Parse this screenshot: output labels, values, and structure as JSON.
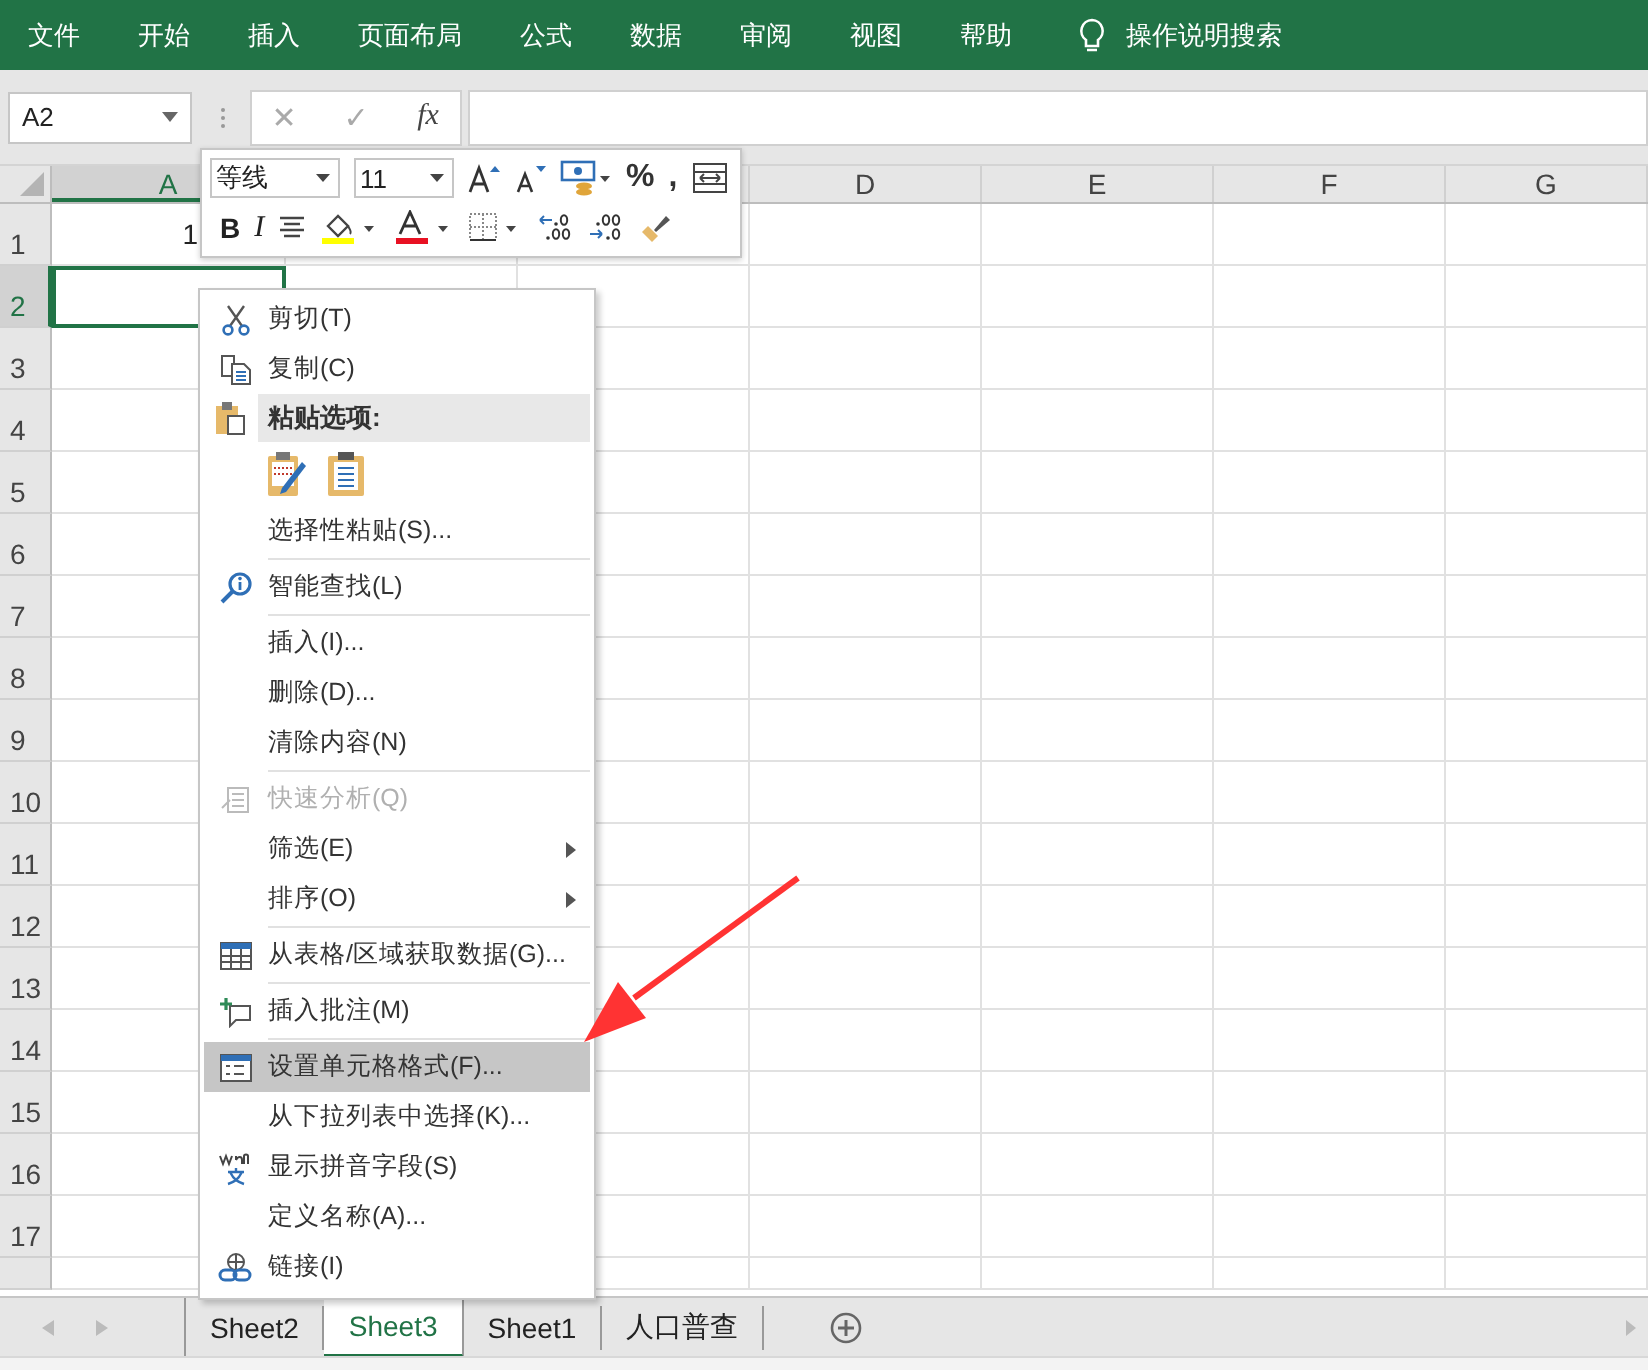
{
  "ribbon_tabs": [
    "文件",
    "开始",
    "插入",
    "页面布局",
    "公式",
    "数据",
    "审阅",
    "视图",
    "帮助"
  ],
  "tell_me": "操作说明搜索",
  "formula_bar": {
    "name_box": "A2",
    "cancel": "✕",
    "enter": "✓",
    "function": "fx"
  },
  "columns": [
    {
      "label": "A",
      "selected": true
    },
    {
      "label": "D",
      "selected": false
    },
    {
      "label": "E",
      "selected": false
    },
    {
      "label": "F",
      "selected": false
    },
    {
      "label": "G",
      "selected": false
    }
  ],
  "rows": [
    {
      "label": "1",
      "selected": false,
      "cells": [
        "1"
      ]
    },
    {
      "label": "2",
      "selected": true,
      "cells": []
    },
    {
      "label": "3",
      "selected": false,
      "cells": []
    },
    {
      "label": "4",
      "selected": false,
      "cells": []
    },
    {
      "label": "5",
      "selected": false,
      "cells": []
    },
    {
      "label": "6",
      "selected": false,
      "cells": []
    },
    {
      "label": "7",
      "selected": false,
      "cells": []
    },
    {
      "label": "8",
      "selected": false,
      "cells": []
    },
    {
      "label": "9",
      "selected": false,
      "cells": []
    },
    {
      "label": "10",
      "selected": false,
      "cells": []
    },
    {
      "label": "11",
      "selected": false,
      "cells": []
    },
    {
      "label": "12",
      "selected": false,
      "cells": []
    },
    {
      "label": "13",
      "selected": false,
      "cells": []
    },
    {
      "label": "14",
      "selected": false,
      "cells": []
    },
    {
      "label": "15",
      "selected": false,
      "cells": []
    },
    {
      "label": "16",
      "selected": false,
      "cells": []
    },
    {
      "label": "17",
      "selected": false,
      "cells": []
    }
  ],
  "mini_toolbar": {
    "font": "等线",
    "size": "11",
    "bold": "B",
    "italic": "I",
    "percent": "%",
    "comma": ","
  },
  "context_menu": [
    {
      "kind": "item",
      "label": "剪切(T)",
      "disabled": false,
      "submenu": false,
      "selected": false
    },
    {
      "kind": "item",
      "label": "复制(C)",
      "disabled": false,
      "submenu": false,
      "selected": false
    },
    {
      "kind": "header",
      "label": "粘贴选项:"
    },
    {
      "kind": "paste_icons"
    },
    {
      "kind": "item",
      "label": "选择性粘贴(S)...",
      "disabled": false,
      "submenu": false,
      "selected": false
    },
    {
      "kind": "separator"
    },
    {
      "kind": "item",
      "label": "智能查找(L)",
      "disabled": false,
      "submenu": false,
      "selected": false
    },
    {
      "kind": "separator"
    },
    {
      "kind": "item",
      "label": "插入(I)...",
      "disabled": false,
      "submenu": false,
      "selected": false
    },
    {
      "kind": "item",
      "label": "删除(D)...",
      "disabled": false,
      "submenu": false,
      "selected": false
    },
    {
      "kind": "item",
      "label": "清除内容(N)",
      "disabled": false,
      "submenu": false,
      "selected": false
    },
    {
      "kind": "separator"
    },
    {
      "kind": "item",
      "label": "快速分析(Q)",
      "disabled": true,
      "submenu": false,
      "selected": false
    },
    {
      "kind": "item",
      "label": "筛选(E)",
      "disabled": false,
      "submenu": true,
      "selected": false
    },
    {
      "kind": "item",
      "label": "排序(O)",
      "disabled": false,
      "submenu": true,
      "selected": false
    },
    {
      "kind": "separator"
    },
    {
      "kind": "item",
      "label": "从表格/区域获取数据(G)...",
      "disabled": false,
      "submenu": false,
      "selected": false
    },
    {
      "kind": "separator"
    },
    {
      "kind": "item",
      "label": "插入批注(M)",
      "disabled": false,
      "submenu": false,
      "selected": false
    },
    {
      "kind": "separator"
    },
    {
      "kind": "item",
      "label": "设置单元格格式(F)...",
      "disabled": false,
      "submenu": false,
      "selected": true
    },
    {
      "kind": "item",
      "label": "从下拉列表中选择(K)...",
      "disabled": false,
      "submenu": false,
      "selected": false
    },
    {
      "kind": "item",
      "label": "显示拼音字段(S)",
      "disabled": false,
      "submenu": false,
      "selected": false
    },
    {
      "kind": "item",
      "label": "定义名称(A)...",
      "disabled": false,
      "submenu": false,
      "selected": false
    },
    {
      "kind": "item",
      "label": "链接(I)",
      "disabled": false,
      "submenu": false,
      "selected": false
    }
  ],
  "sheet_tabs": [
    {
      "label": "Sheet2",
      "selected": false
    },
    {
      "label": "Sheet3",
      "selected": true
    },
    {
      "label": "Sheet1",
      "selected": false
    },
    {
      "label": "人口普查",
      "selected": false
    }
  ]
}
